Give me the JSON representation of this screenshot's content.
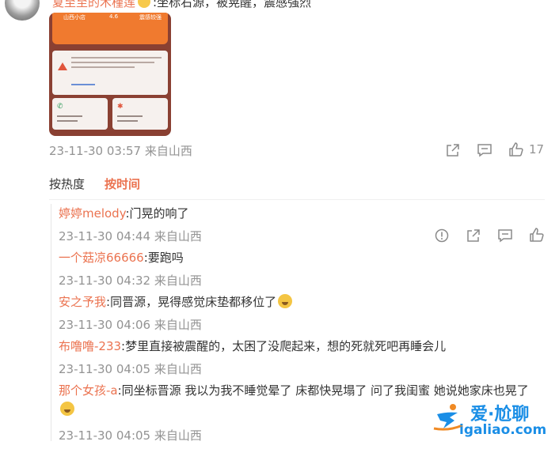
{
  "post": {
    "top_nick": "夏至至的木槿莲",
    "top_text": ":坐标右源，被晃醒，震感强烈",
    "thumbnail": {
      "tab1": "山西小店",
      "tab2": "4.6",
      "tab3": "震感较强",
      "ok_icon": "phone-icon",
      "star_icon": "asterisk-icon"
    },
    "meta": "23-11-30 03:57 来自山西",
    "like_count": "17"
  },
  "sort": {
    "hot": "按热度",
    "time": "按时间"
  },
  "replies": [
    {
      "nick": "婷婷melody",
      "text": ":门晃的响了",
      "meta": "23-11-30 04:44 来自山西"
    },
    {
      "nick": "一个菇凉66666",
      "text": ":要跑吗",
      "meta": "23-11-30 04:32 来自山西"
    },
    {
      "nick": "安之予我",
      "text": ":同晋源，晃得感觉床垫都移位了",
      "meta": "23-11-30 04:06 来自山西"
    },
    {
      "nick": "布噜噜-233",
      "text": ":梦里直接被震醒的，太困了没爬起来，想的死就死吧再睡会儿",
      "meta": "23-11-30 04:05 来自山西"
    },
    {
      "nick": "那个女孩-a",
      "text": ":同坐标晋源 我以为我不睡觉晕了 床都快晃塌了 问了我闺蜜 她说她家床也晃了",
      "meta": "23-11-30 04:05 来自山西"
    }
  ],
  "watermark": {
    "name": "爱·尬聊",
    "url": "igaliao.com"
  },
  "colors": {
    "accent": "#eb7350",
    "meta": "#939393",
    "watermark": "#1a8ee6"
  }
}
